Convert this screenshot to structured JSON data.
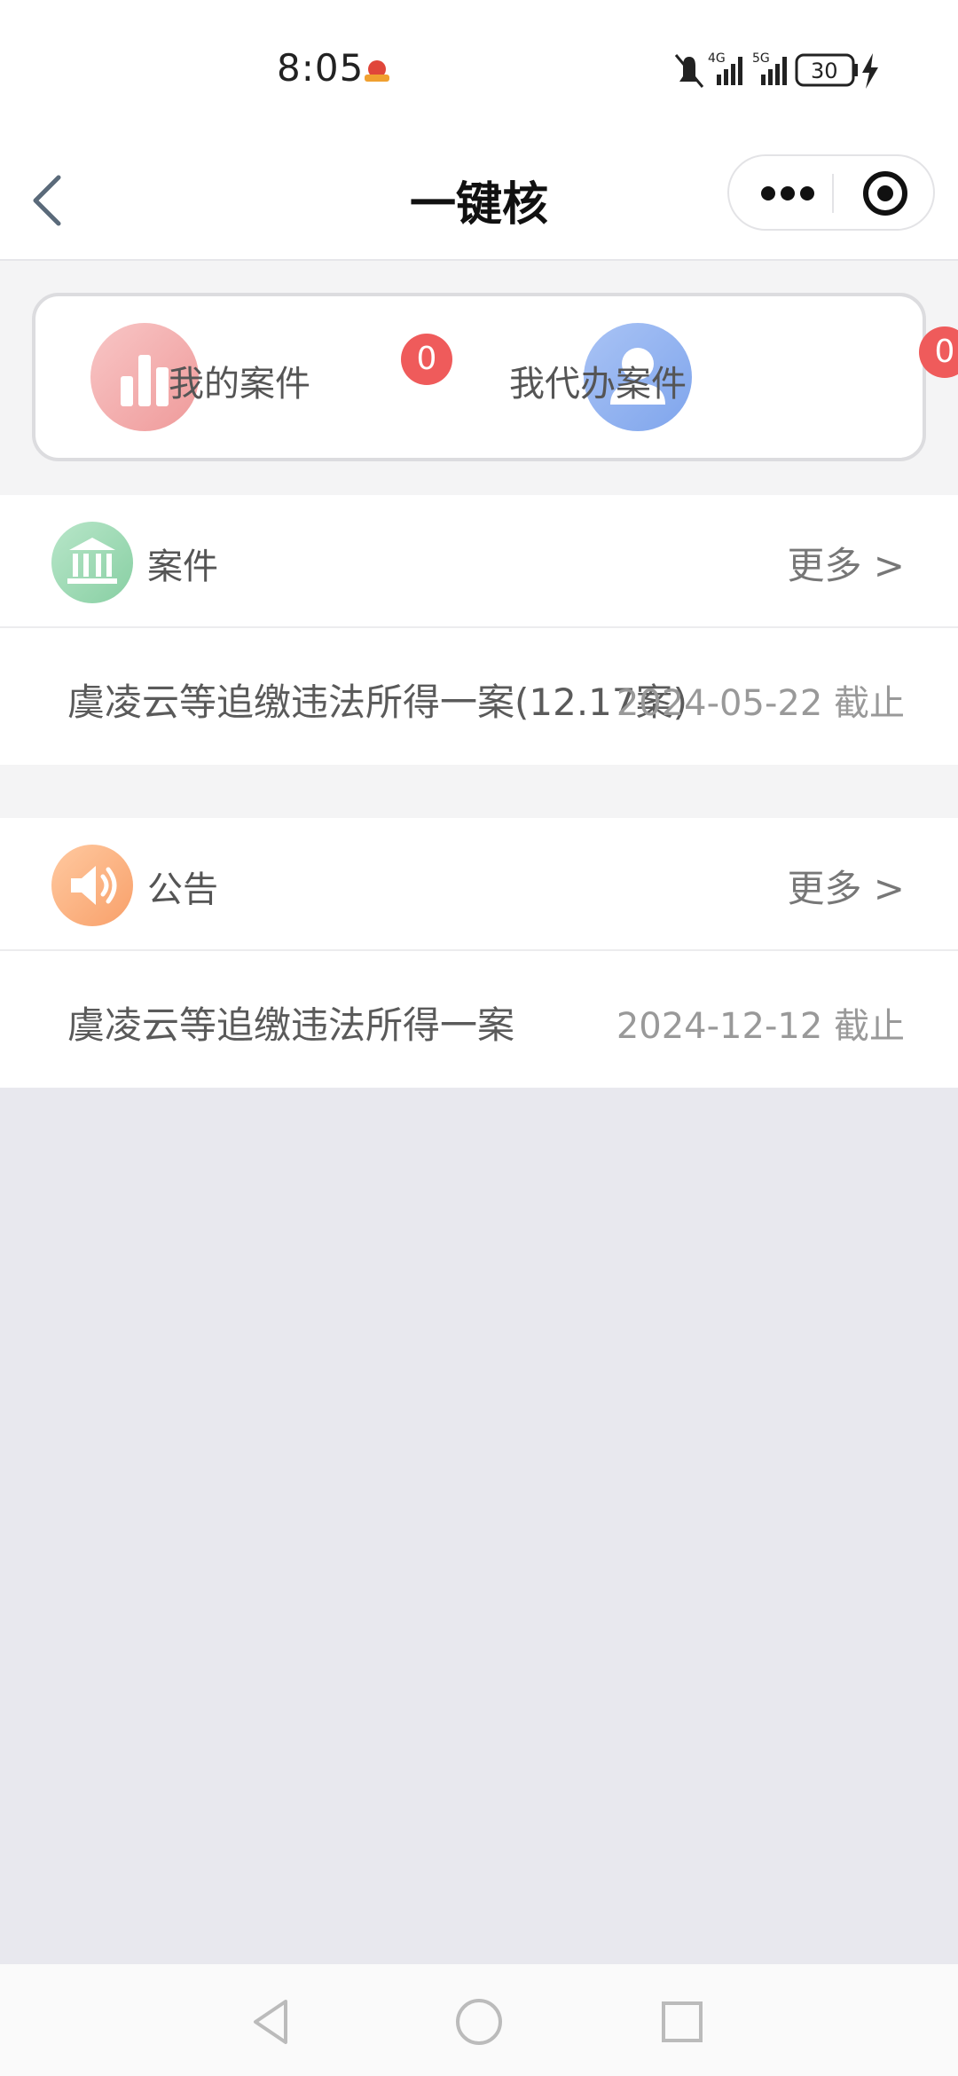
{
  "status_bar": {
    "time": "8:05",
    "battery": "30",
    "network_1": "4G",
    "network_2": "5G"
  },
  "nav": {
    "title": "一键核"
  },
  "card": {
    "my_cases_label": "我的案件",
    "my_cases_count": "0",
    "proxy_cases_label": "我代办案件",
    "proxy_cases_count": "0"
  },
  "cases_section": {
    "title": "案件",
    "more": "更多 >",
    "items": [
      {
        "title": "虞凌云等追缴违法所得一案(12.17案)",
        "date": "2024-05-22 截止"
      }
    ]
  },
  "notices_section": {
    "title": "公告",
    "more": "更多 >",
    "items": [
      {
        "title": "虞凌云等追缴违法所得一案",
        "date": "2024-12-12 截止"
      }
    ]
  },
  "colors": {
    "badge": "#ef5b5b",
    "page_bg": "#e8e8ee",
    "cases_icon": "#88cfa3",
    "notices_icon": "#f8a06a"
  }
}
